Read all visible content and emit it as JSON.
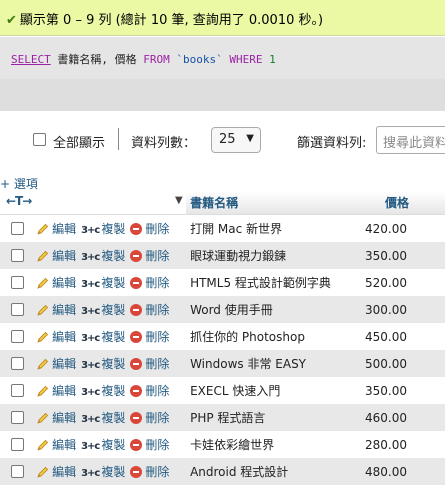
{
  "success": {
    "icon": "check-icon",
    "message": "顯示第 0 – 9 列 (總計 10 筆, 查詢用了 0.0010 秒。)"
  },
  "sql": {
    "select": "SELECT",
    "columns": "書籍名稱, 價格",
    "from": "FROM",
    "table": "`books`",
    "where": "WHERE",
    "condition": "1"
  },
  "options": {
    "show_all": "全部顯示",
    "row_count_label": "資料列數：",
    "row_count_value": "25",
    "filter_label": "篩選資料列:",
    "search_placeholder": "搜尋此資料"
  },
  "table": {
    "options_link": "+ 選項",
    "headers": {
      "name": "書籍名稱",
      "price": "價格"
    },
    "actions": {
      "edit": "編輯",
      "copy": "複製",
      "delete": "刪除"
    },
    "rows": [
      {
        "name": "打開 Mac 新世界",
        "price": "420.00"
      },
      {
        "name": "眼球運動視力鍛鍊",
        "price": "350.00"
      },
      {
        "name": "HTML5 程式設計範例字典",
        "price": "520.00"
      },
      {
        "name": "Word 使用手冊",
        "price": "300.00"
      },
      {
        "name": "抓住你的 Photoshop",
        "price": "450.00"
      },
      {
        "name": "Windows 非常 EASY",
        "price": "500.00"
      },
      {
        "name": "EXECL 快速入門",
        "price": "350.00"
      },
      {
        "name": "PHP 程式語言",
        "price": "460.00"
      },
      {
        "name": "卡娃依彩繪世界",
        "price": "280.00"
      },
      {
        "name": "Android 程式設計",
        "price": "480.00"
      }
    ]
  }
}
